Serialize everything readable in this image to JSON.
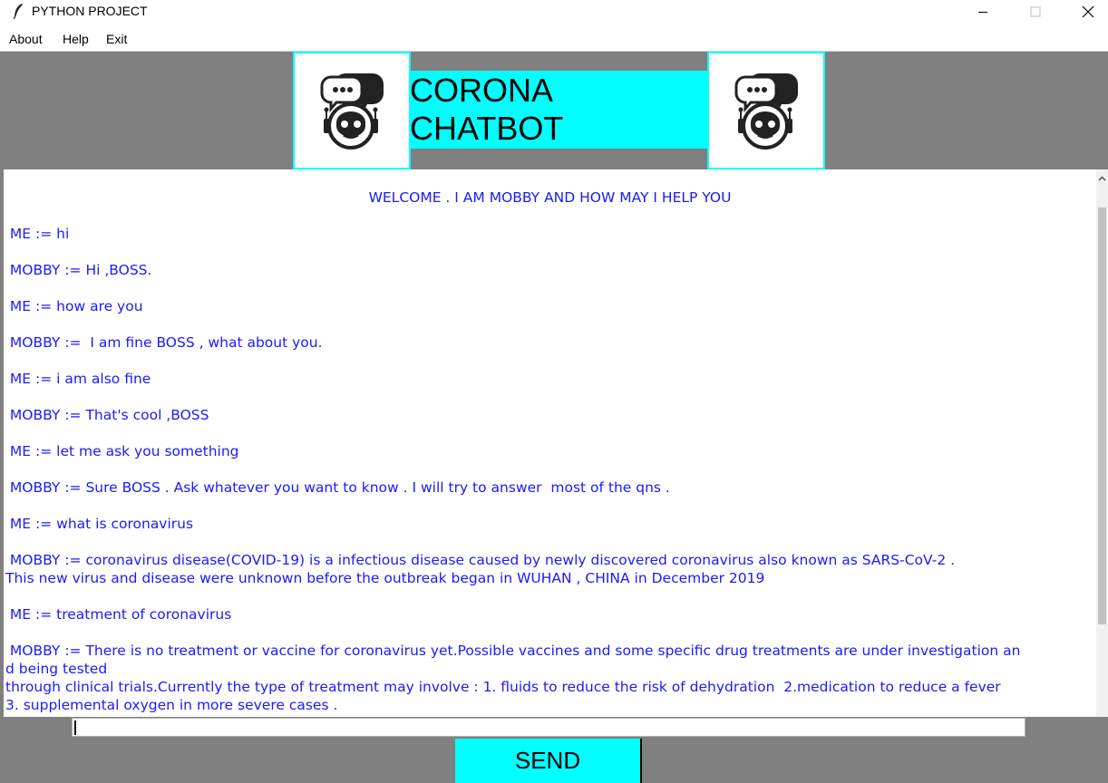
{
  "window": {
    "title": "PYTHON PROJECT"
  },
  "menu": {
    "items": [
      "About",
      "Help",
      "Exit"
    ]
  },
  "header": {
    "title": "CORONA CHATBOT"
  },
  "chat": {
    "lines": [
      "WELCOME . I AM MOBBY AND HOW MAY I HELP YOU",
      " ME := hi",
      " MOBBY := Hi ,BOSS.",
      " ME := how are you",
      " MOBBY :=  I am fine BOSS , what about you.",
      " ME := i am also fine",
      " MOBBY := That's cool ,BOSS",
      " ME := let me ask you something",
      " MOBBY := Sure BOSS . Ask whatever you want to know . I will try to answer  most of the qns .",
      " ME := what is coronavirus",
      " MOBBY := coronavirus disease(COVID-19) is a infectious disease caused by newly discovered coronavirus also known as SARS-CoV-2 .",
      "This new virus and disease were unknown before the outbreak began in WUHAN , CHINA in December 2019",
      " ME := treatment of coronavirus",
      " MOBBY := There is no treatment or vaccine for coronavirus yet.Possible vaccines and some specific drug treatments are under investigation an",
      "d being tested",
      "through clinical trials.Currently the type of treatment may involve : 1. fluids to reduce the risk of dehydration  2.medication to reduce a fever",
      "3. supplemental oxygen in more severe cases ."
    ]
  },
  "input": {
    "value": ""
  },
  "send_button": {
    "label": "SEND"
  },
  "colors": {
    "accent": "#00ffff",
    "chat_text": "#1a1aff",
    "background": "#808080"
  },
  "icons": {
    "app": "feather-icon",
    "logo": "robot-chat-icon"
  }
}
